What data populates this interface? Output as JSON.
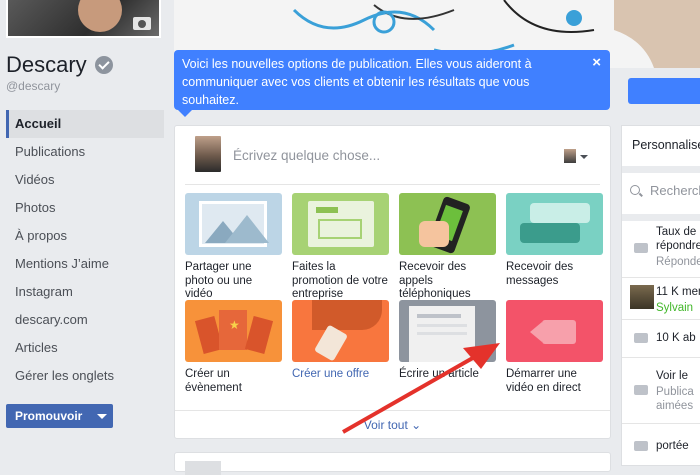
{
  "page": {
    "name": "Descary",
    "handle": "@descary"
  },
  "nav": {
    "items": [
      {
        "label": "Accueil",
        "active": true
      },
      {
        "label": "Publications"
      },
      {
        "label": "Vidéos"
      },
      {
        "label": "Photos"
      },
      {
        "label": "À propos"
      },
      {
        "label": "Mentions J’aime"
      },
      {
        "label": "Instagram"
      },
      {
        "label": "descary.com"
      },
      {
        "label": "Articles"
      },
      {
        "label": "Gérer les onglets"
      }
    ],
    "promote_label": "Promouvoir"
  },
  "tooltip": {
    "text": "Voici les nouvelles options de publication. Elles vous aideront à communiquer avec vos clients et obtenir les résultats que vous souhaitez.",
    "close": "×"
  },
  "composer": {
    "placeholder": "Écrivez quelque chose...",
    "tiles": [
      {
        "label": "Partager une photo ou une vidéo",
        "color": "#bcd5e6",
        "icon": "photo-icon"
      },
      {
        "label": "Faites la promotion de votre entreprise",
        "color": "#a7d274",
        "icon": "promote-icon"
      },
      {
        "label": "Recevoir des appels téléphoniques",
        "color": "#8dc153",
        "icon": "phone-icon"
      },
      {
        "label": "Recevoir des messages",
        "color": "#7ad1c3",
        "icon": "messages-icon"
      },
      {
        "label": "Créer un évènement",
        "color": "#f7923a",
        "icon": "event-icon"
      },
      {
        "label": "Créer une offre",
        "color": "#f8763e",
        "icon": "offer-icon",
        "link": true
      },
      {
        "label": "Écrire un article",
        "color": "#8d949e",
        "icon": "article-icon"
      },
      {
        "label": "Démarrer une vidéo en direct",
        "color": "#f35369",
        "icon": "live-video-icon"
      }
    ],
    "see_all": "Voir tout"
  },
  "right_panel": {
    "custom": "Personnaliser",
    "search": "Rechercher",
    "rows": [
      {
        "line1": "Taux de r",
        "line2": "répondre",
        "line3": "Répondez"
      },
      {
        "line1": "11 K mem",
        "line2": "Sylvain"
      },
      {
        "line1": "10 K ab"
      },
      {
        "line1": "Voir le",
        "line2": "Publica",
        "line3": "aimées"
      },
      {
        "line1": "portée"
      }
    ]
  }
}
